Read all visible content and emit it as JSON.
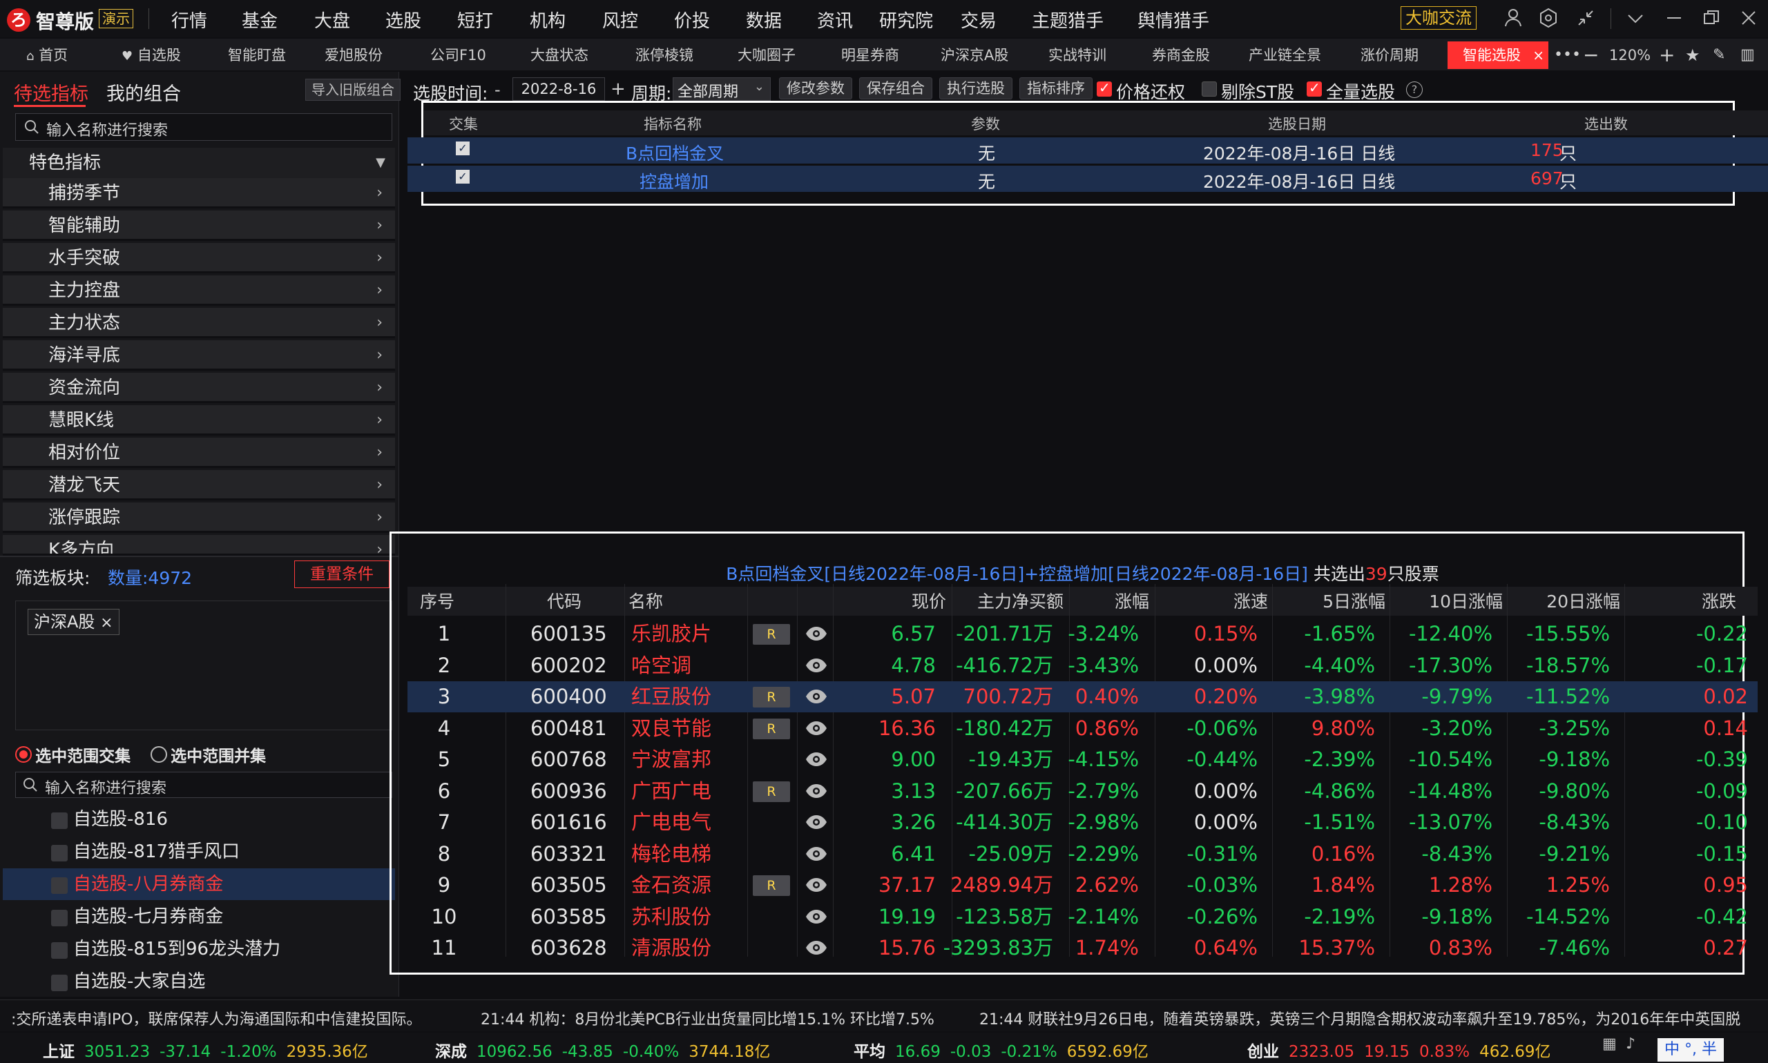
{
  "app": {
    "brand": "智尊版",
    "demo_badge": "演示",
    "menu": [
      "行情",
      "基金",
      "大盘",
      "选股",
      "短打",
      "机构",
      "风控",
      "价投",
      "数据",
      "资讯",
      "研究院",
      "交易",
      "主题猎手",
      "舆情猎手"
    ],
    "right_badge": "大咖交流"
  },
  "tabs": {
    "items": [
      "首页",
      "自选股",
      "智能盯盘",
      "爱旭股份",
      "公司F10",
      "大盘状态",
      "涨停棱镜",
      "大咖圈子",
      "明星券商",
      "沪深京A股",
      "实战特训",
      "券商金股",
      "产业链全景",
      "涨价周期",
      "智能选股"
    ],
    "active_index": 14,
    "zoom": "120%"
  },
  "left": {
    "tab_active": "待选指标",
    "tab_other": "我的组合",
    "import_btn": "导入旧版组合",
    "search_placeholder": "输入名称进行搜索",
    "category": "特色指标",
    "indicators": [
      "捕捞季节",
      "智能辅助",
      "水手突破",
      "主力控盘",
      "主力状态",
      "海洋寻底",
      "资金流向",
      "慧眼K线",
      "相对价位",
      "潜龙飞天",
      "涨停跟踪",
      "K多方向"
    ],
    "filter_label": "筛选板块:",
    "count_label": "数量:4972",
    "reset_btn": "重置条件",
    "tag": "沪深A股",
    "radio_intersect": "选中范围交集",
    "radio_union": "选中范围并集",
    "search2_placeholder": "输入名称进行搜索",
    "groups": [
      "自选股-816",
      "自选股-817猎手风口",
      "自选股-八月券商金",
      "自选股-七月券商金",
      "自选股-815到96龙头潜力",
      "自选股-大家自选"
    ],
    "group_selected": 2
  },
  "toolbar": {
    "time_label": "选股时间:",
    "minus": "-",
    "date": "2022-8-16",
    "plus": "+",
    "period_label": "周期:",
    "period_value": "全部周期",
    "btn_modify": "修改参数",
    "btn_save": "保存组合",
    "btn_run": "执行选股",
    "btn_sort": "指标排序",
    "cb_price": "价格还权",
    "cb_st": "剔除ST股",
    "cb_full": "全量选股"
  },
  "criteria": {
    "headers": [
      "交集",
      "指标名称",
      "参数",
      "选股日期",
      "选出数"
    ],
    "rows": [
      {
        "name": "B点回档金叉",
        "param": "无",
        "date": "2022年-08月-16日 日线",
        "count": "175",
        "unit": "只"
      },
      {
        "name": "控盘增加",
        "param": "无",
        "date": "2022年-08月-16日 日线",
        "count": "697",
        "unit": "只"
      }
    ]
  },
  "results": {
    "summary": "B点回档金叉[日线2022年-08月-16日]+控盘增加[日线2022年-08月-16日]",
    "summary_tail1": " 共选出",
    "total": "39",
    "summary_tail2": "只股票",
    "headers": [
      "序号",
      "代码",
      "名称",
      "现价",
      "主力净买额",
      "涨幅",
      "涨速",
      "5日涨幅",
      "10日涨幅",
      "20日涨幅",
      "涨跌"
    ],
    "rows": [
      [
        "1",
        "600135",
        "乐凯胶片",
        "6.57",
        "-201.71万",
        "-3.24%",
        "0.15%",
        "-1.65%",
        "-12.40%",
        "-15.55%",
        "-0.22"
      ],
      [
        "2",
        "600202",
        "哈空调",
        "4.78",
        "-416.72万",
        "-3.43%",
        "0.00%",
        "-4.40%",
        "-17.30%",
        "-18.57%",
        "-0.17"
      ],
      [
        "3",
        "600400",
        "红豆股份",
        "5.07",
        "700.72万",
        "0.40%",
        "0.20%",
        "-3.98%",
        "-9.79%",
        "-11.52%",
        "0.02"
      ],
      [
        "4",
        "600481",
        "双良节能",
        "16.36",
        "-180.42万",
        "0.86%",
        "-0.06%",
        "9.80%",
        "-3.20%",
        "-3.25%",
        "0.14"
      ],
      [
        "5",
        "600768",
        "宁波富邦",
        "9.00",
        "-19.43万",
        "-4.15%",
        "-0.44%",
        "-2.39%",
        "-10.54%",
        "-9.18%",
        "-0.39"
      ],
      [
        "6",
        "600936",
        "广西广电",
        "3.13",
        "-207.66万",
        "-2.79%",
        "0.00%",
        "-4.86%",
        "-14.48%",
        "-9.80%",
        "-0.09"
      ],
      [
        "7",
        "601616",
        "广电电气",
        "3.26",
        "-414.30万",
        "-2.98%",
        "0.00%",
        "-1.51%",
        "-13.07%",
        "-8.43%",
        "-0.10"
      ],
      [
        "8",
        "603321",
        "梅轮电梯",
        "6.41",
        "-25.09万",
        "-2.29%",
        "-0.31%",
        "0.16%",
        "-8.43%",
        "-9.21%",
        "-0.15"
      ],
      [
        "9",
        "603505",
        "金石资源",
        "37.17",
        "2489.94万",
        "2.62%",
        "-0.03%",
        "1.84%",
        "1.28%",
        "1.25%",
        "0.95"
      ],
      [
        "10",
        "603585",
        "苏利股份",
        "19.19",
        "-123.58万",
        "-2.14%",
        "-0.26%",
        "-2.19%",
        "-9.18%",
        "-14.52%",
        "-0.42"
      ],
      [
        "11",
        "603628",
        "清源股份",
        "15.76",
        "-3293.83万",
        "1.74%",
        "0.64%",
        "15.37%",
        "0.83%",
        "-7.46%",
        "0.27"
      ]
    ],
    "r_badge_rows": [
      0,
      2,
      3,
      5,
      8
    ],
    "badge_letter": "R",
    "selected_row": 2
  },
  "news": {
    "item1": ":交所递表申请IPO，联席保荐人为海通国际和中信建投国际。",
    "item2": "21:44 机构：8月份北美PCB行业出货量同比增15.1% 环比增7.5%",
    "item3": "21:44 财联社9月26日电，随着英镑暴跌，英镑三个月期隐含期权波动率飙升至19.785%，为2016年年中英国脱"
  },
  "indices": [
    {
      "name": "上证",
      "price": "3051.23",
      "chg": "-37.14",
      "pct": "-1.20%",
      "amt": "2935.36亿",
      "up": false
    },
    {
      "name": "深成",
      "price": "10962.56",
      "chg": "-43.85",
      "pct": "-0.40%",
      "amt": "3744.18亿",
      "up": false
    },
    {
      "name": "平均",
      "price": "16.69",
      "chg": "-0.03",
      "pct": "-0.21%",
      "amt": "6592.69亿",
      "up": false
    },
    {
      "name": "创业",
      "price": "2323.05",
      "chg": "19.15",
      "pct": "0.83%",
      "amt": "462.69亿",
      "up": true
    }
  ],
  "ime": "中 °, 半"
}
